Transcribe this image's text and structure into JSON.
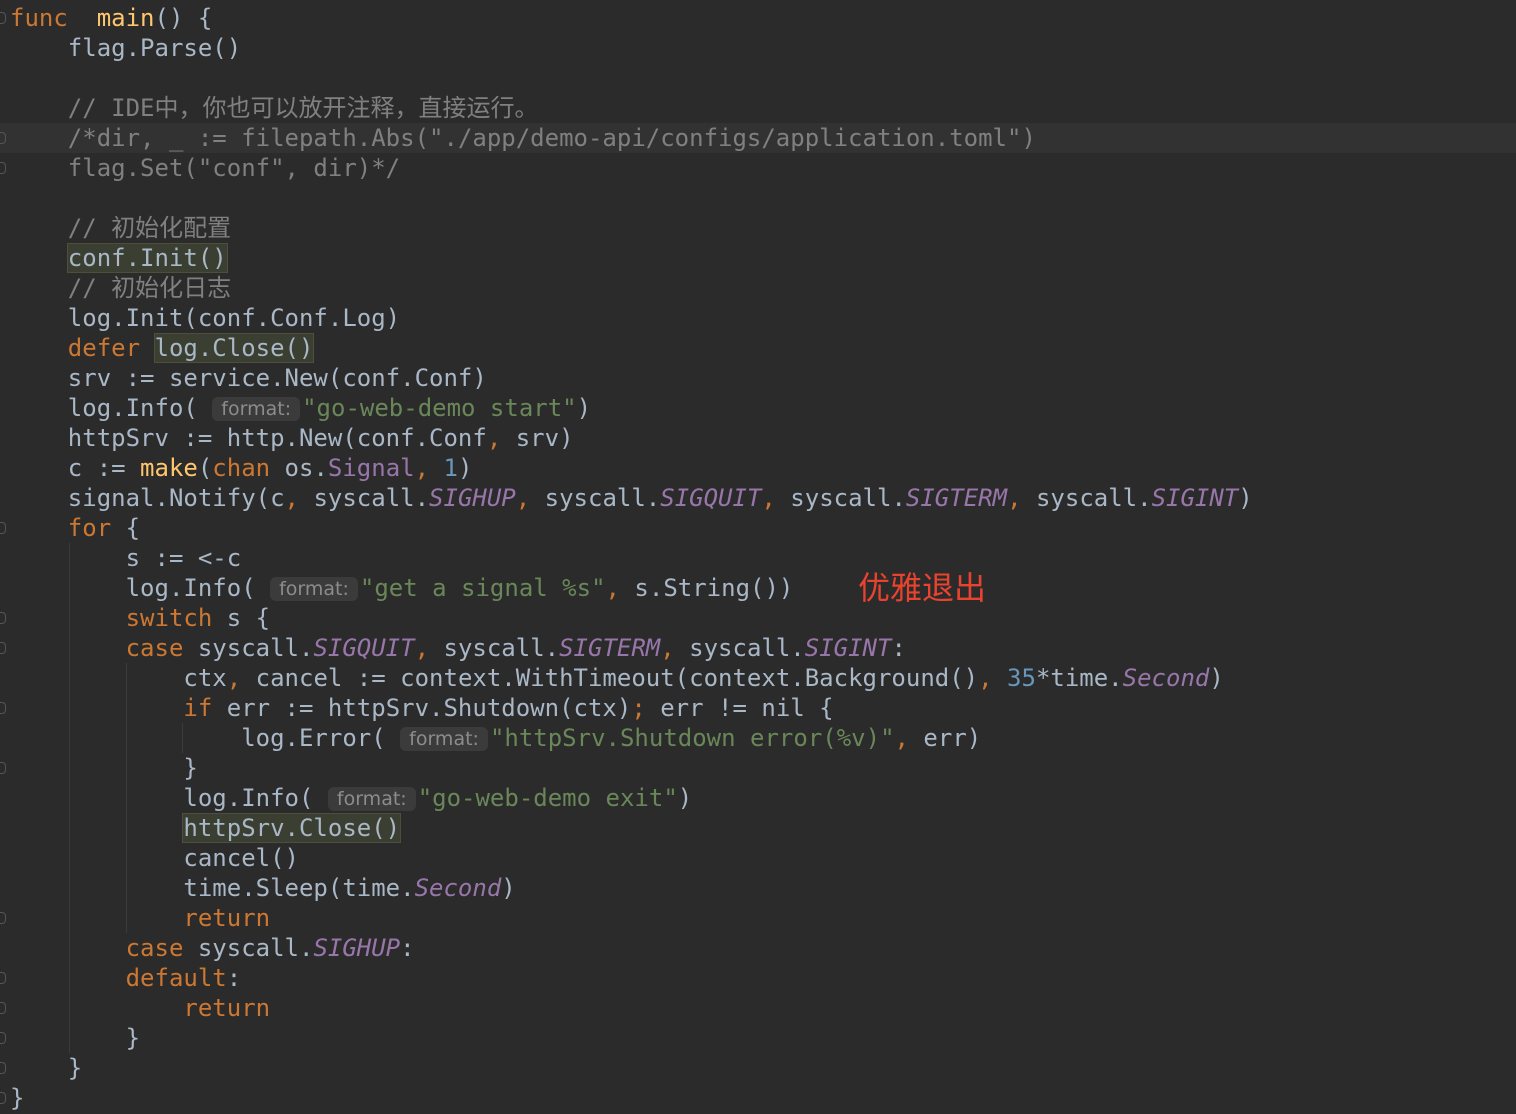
{
  "lines": [
    [
      [
        "kw",
        "func"
      ],
      [
        "",
        "  "
      ],
      [
        "fn",
        "main"
      ],
      [
        "",
        "() {"
      ]
    ],
    [
      [
        "",
        "    flag.Parse()"
      ]
    ],
    [],
    [
      [
        "",
        "    "
      ],
      [
        "cm",
        "// IDE中，你也可以放开注释，直接运行。"
      ]
    ],
    [
      [
        "",
        "    "
      ],
      [
        "cm",
        "/*dir, _ := filepath.Abs(\"./app/demo-api/configs/application.toml\")"
      ]
    ],
    [
      [
        "",
        "    "
      ],
      [
        "cm",
        "flag.Set(\"conf\", dir)*/"
      ]
    ],
    [],
    [
      [
        "",
        "    "
      ],
      [
        "cm",
        "// 初始化配置"
      ]
    ],
    [
      [
        "",
        "    "
      ],
      [
        "hl",
        "conf.Init()"
      ]
    ],
    [
      [
        "",
        "    "
      ],
      [
        "cm",
        "// 初始化日志"
      ]
    ],
    [
      [
        "",
        "    log.Init(conf.Conf.Log)"
      ]
    ],
    [
      [
        "",
        "    "
      ],
      [
        "kw",
        "defer"
      ],
      [
        "",
        " "
      ],
      [
        "hl",
        "log.Close()"
      ]
    ],
    [
      [
        "",
        "    srv := service.New(conf.Conf)"
      ]
    ],
    [
      [
        "",
        "    log.Info( "
      ],
      [
        "hint",
        "format:"
      ],
      [
        "str",
        "\"go-web-demo start\""
      ],
      [
        "",
        ")"
      ]
    ],
    [
      [
        "",
        "    httpSrv := http.New(conf.Conf"
      ],
      [
        "kw",
        ","
      ],
      [
        "",
        " srv)"
      ]
    ],
    [
      [
        "",
        "    c := "
      ],
      [
        "fn",
        "make"
      ],
      [
        "",
        "("
      ],
      [
        "kw",
        "chan"
      ],
      [
        "",
        " os."
      ],
      [
        "pkgtype",
        "Signal"
      ],
      [
        "kw",
        ","
      ],
      [
        "",
        " "
      ],
      [
        "num",
        "1"
      ],
      [
        "",
        ")"
      ]
    ],
    [
      [
        "",
        "    signal.Notify(c"
      ],
      [
        "kw",
        ","
      ],
      [
        "",
        " syscall."
      ],
      [
        "const",
        "SIGHUP"
      ],
      [
        "kw",
        ","
      ],
      [
        "",
        " syscall."
      ],
      [
        "const",
        "SIGQUIT"
      ],
      [
        "kw",
        ","
      ],
      [
        "",
        " syscall."
      ],
      [
        "const",
        "SIGTERM"
      ],
      [
        "kw",
        ","
      ],
      [
        "",
        " syscall."
      ],
      [
        "const",
        "SIGINT"
      ],
      [
        "",
        ")"
      ]
    ],
    [
      [
        "",
        "    "
      ],
      [
        "kw",
        "for"
      ],
      [
        "",
        " {"
      ]
    ],
    [
      [
        "",
        "        s := <-c"
      ]
    ],
    [
      [
        "",
        "        log.Info( "
      ],
      [
        "hint",
        "format:"
      ],
      [
        "str",
        "\"get a signal %s\""
      ],
      [
        "kw",
        ","
      ],
      [
        "",
        " s.String())"
      ]
    ],
    [
      [
        "",
        "        "
      ],
      [
        "kw",
        "switch"
      ],
      [
        "",
        " s {"
      ]
    ],
    [
      [
        "",
        "        "
      ],
      [
        "kw",
        "case"
      ],
      [
        "",
        " syscall."
      ],
      [
        "const",
        "SIGQUIT"
      ],
      [
        "kw",
        ","
      ],
      [
        "",
        " syscall."
      ],
      [
        "const",
        "SIGTERM"
      ],
      [
        "kw",
        ","
      ],
      [
        "",
        " syscall."
      ],
      [
        "const",
        "SIGINT"
      ],
      [
        "",
        ":"
      ]
    ],
    [
      [
        "",
        "            ctx"
      ],
      [
        "kw",
        ","
      ],
      [
        "",
        " cancel := context.WithTimeout(context.Background()"
      ],
      [
        "kw",
        ","
      ],
      [
        "",
        " "
      ],
      [
        "num",
        "35"
      ],
      [
        "",
        "*time."
      ],
      [
        "const",
        "Second"
      ],
      [
        "",
        ")"
      ]
    ],
    [
      [
        "",
        "            "
      ],
      [
        "kw",
        "if"
      ],
      [
        "",
        " err := httpSrv.Shutdown(ctx)"
      ],
      [
        "kw",
        ";"
      ],
      [
        "",
        " err != nil {"
      ]
    ],
    [
      [
        "",
        "                log.Error( "
      ],
      [
        "hint",
        "format:"
      ],
      [
        "str",
        "\"httpSrv.Shutdown error(%v)\""
      ],
      [
        "kw",
        ","
      ],
      [
        "",
        " err)"
      ]
    ],
    [
      [
        "",
        "            }"
      ]
    ],
    [
      [
        "",
        "            log.Info( "
      ],
      [
        "hint",
        "format:"
      ],
      [
        "str",
        "\"go-web-demo exit\""
      ],
      [
        "",
        ")"
      ]
    ],
    [
      [
        "",
        "            "
      ],
      [
        "hl",
        "httpSrv.Close()"
      ]
    ],
    [
      [
        "",
        "            cancel()"
      ]
    ],
    [
      [
        "",
        "            time.Sleep(time."
      ],
      [
        "const",
        "Second"
      ],
      [
        "",
        ")"
      ]
    ],
    [
      [
        "",
        "            "
      ],
      [
        "kw",
        "return"
      ]
    ],
    [
      [
        "",
        "        "
      ],
      [
        "kw",
        "case"
      ],
      [
        "",
        " syscall."
      ],
      [
        "const",
        "SIGHUP"
      ],
      [
        "",
        ":"
      ]
    ],
    [
      [
        "",
        "        "
      ],
      [
        "kw",
        "default"
      ],
      [
        "",
        ":"
      ]
    ],
    [
      [
        "",
        "            "
      ],
      [
        "kw",
        "return"
      ]
    ],
    [
      [
        "",
        "        }"
      ]
    ],
    [
      [
        "",
        "    }"
      ]
    ],
    [
      [
        "",
        "}"
      ]
    ]
  ],
  "annotation": "优雅退出",
  "colors": {
    "background": "#2b2b2b",
    "text": "#a9b7c6",
    "keyword": "#cc7832",
    "function": "#ffc66d",
    "string": "#6a8759",
    "comment": "#808080",
    "number": "#6897bb",
    "constant": "#9876aa",
    "annotation": "#e8432e"
  }
}
